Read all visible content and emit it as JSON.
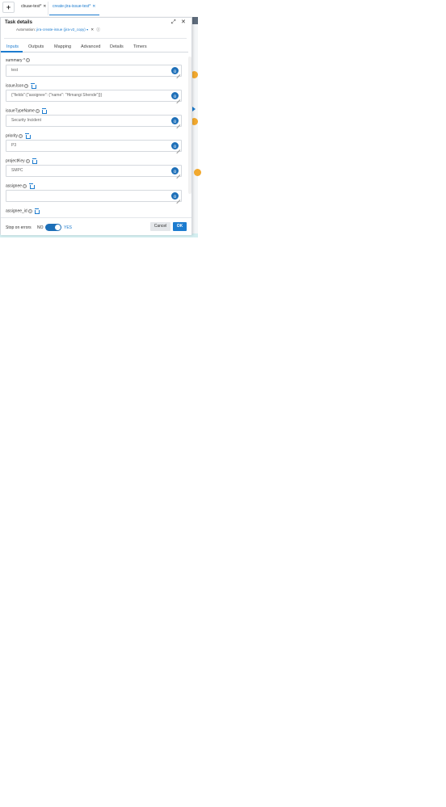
{
  "tabs": {
    "add_label": "+",
    "items": [
      {
        "label": "cbuae-test*",
        "close": "✕"
      },
      {
        "label": "create-jira-issue-test*",
        "close": "✕"
      }
    ]
  },
  "dialog": {
    "title": "Task details",
    "expand_icon": "⤢",
    "close_icon": "✕",
    "automation_label": "Automation:",
    "automation_value": "jira-create-issue (jira-v2_copy)",
    "automation_caret": "▾",
    "automation_clear": "✕",
    "automation_info": "ⓘ",
    "tabs": [
      "Inputs",
      "Outputs",
      "Mapping",
      "Advanced",
      "Details",
      "Timers"
    ],
    "active_tab": "Inputs",
    "fields": [
      {
        "label": "summary *",
        "value": "test",
        "has_trash": false
      },
      {
        "label": "issueJson",
        "value": "{\"fields\":{\"assignee\": {\"name\": \"Himangi Shende\"}}}",
        "has_trash": true
      },
      {
        "label": "issueTypeName",
        "value": "Security Incident",
        "has_trash": true
      },
      {
        "label": "priority",
        "value": "P3",
        "has_trash": true
      },
      {
        "label": "projectKey",
        "value": "SMPC",
        "has_trash": true
      },
      {
        "label": "assignee",
        "value": "",
        "has_trash": true
      },
      {
        "label": "assignee_id",
        "value": "",
        "has_trash": true
      }
    ],
    "help_icon": "?",
    "var_icon": "{}",
    "footer": {
      "stop_on_errors_label": "Stop on errors",
      "no_label": "NO",
      "yes_label": "YES",
      "toggle_on": true,
      "cancel_label": "Cancel",
      "ok_label": "OK"
    }
  },
  "colors": {
    "accent": "#1d7ccf",
    "toggle": "#1d6fb8",
    "node": "#f2a92f",
    "band": "#d4eef0"
  }
}
